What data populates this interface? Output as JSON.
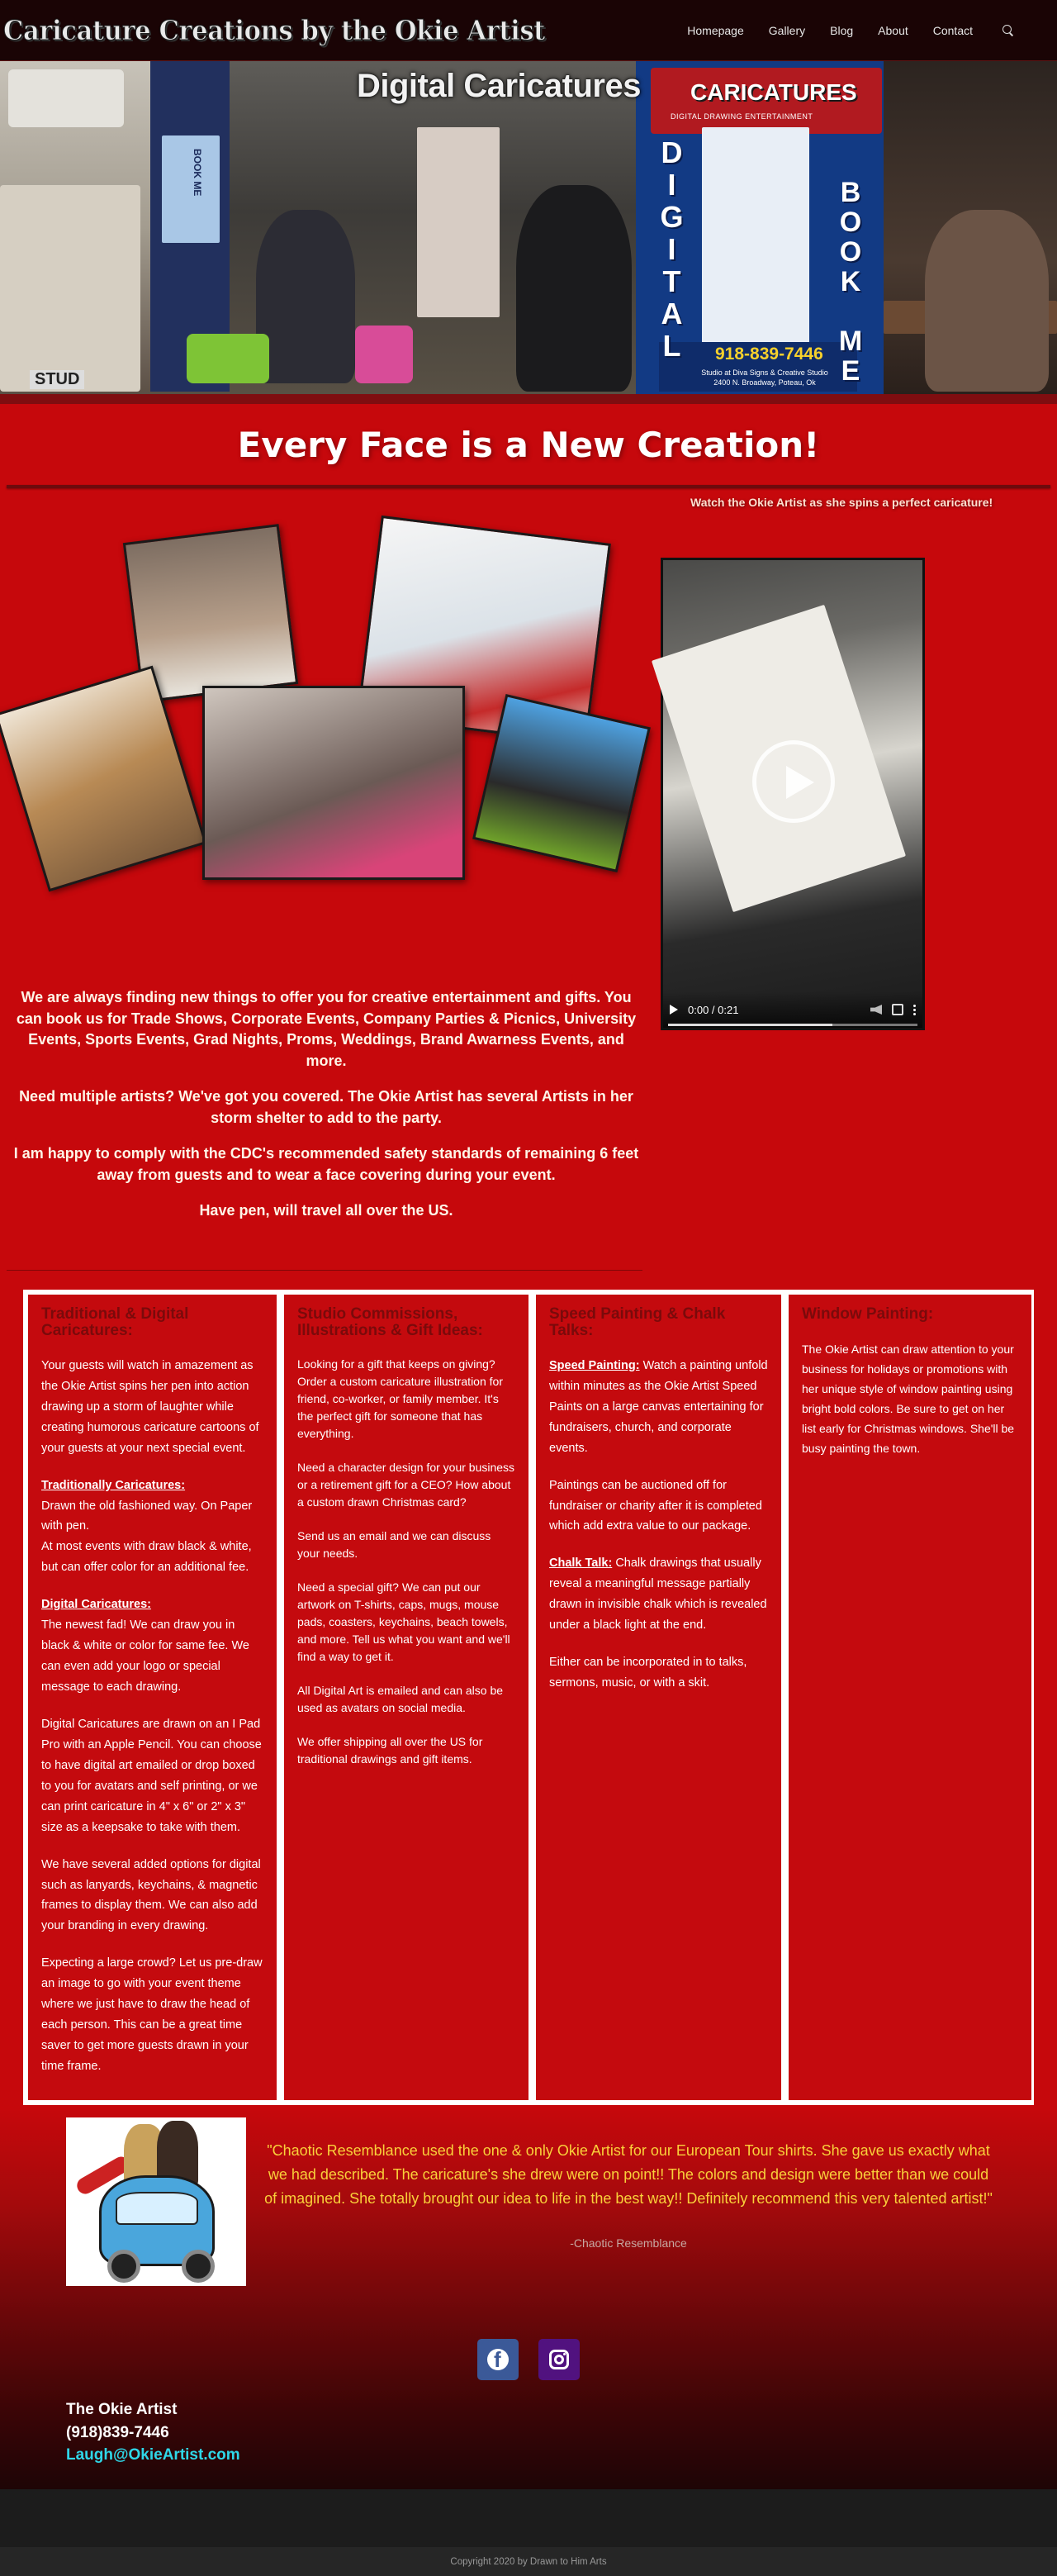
{
  "header": {
    "logo": "Caricature Creations by the Okie Artist",
    "nav": [
      "Homepage",
      "Gallery",
      "Blog",
      "About",
      "Contact"
    ]
  },
  "banner": {
    "title": "Digital Caricatures",
    "caricatures": "CARICATURES",
    "tagline": "DIGITAL DRAWING ENTERTAINMENT",
    "vertical_left": "DIGITAL",
    "vertical_right": "BOOK ME",
    "booth_label": "BOOK ME",
    "phone": "918-839-7446",
    "studio": "Studio at Diva Signs & Creative Studio 2400 N. Broadway, Poteau, Ok",
    "stud_sign": "STUD"
  },
  "hero": {
    "title": "Every Face is a New Creation!"
  },
  "video": {
    "caption": "Watch the Okie Artist as she spins a perfect caricature!",
    "time": "0:00 / 0:21",
    "progress": 0.66
  },
  "intro": {
    "paragraphs": [
      "We are always finding new things to offer you for creative entertainment and gifts. You can book us for Trade Shows, Corporate Events, Company Parties & Picnics, University Events, Sports Events, Grad Nights, Proms, Weddings, Brand Awarness Events, and more.",
      "Need multiple artists? We've got you covered. The Okie Artist has several Artists in her storm shelter to add to the party.",
      "I am happy to comply with the CDC's recommended safety standards of remaining 6 feet away from guests and to wear a face covering during your event.",
      "Have pen, will travel all over the US."
    ]
  },
  "columns": [
    {
      "title": "Traditional & Digital Caricatures:",
      "blocks": [
        {
          "lead": "",
          "text": "Your guests will watch in amazement as the Okie Artist spins her pen into action drawing up a storm of laughter while creating humorous caricature cartoons of your guests at your next special event."
        },
        {
          "lead": "Traditionally Caricatures:",
          "text": "Drawn the old fashioned way. On Paper with pen.\nAt most events with draw black & white, but can offer color for an additional fee."
        },
        {
          "lead": "Digital Caricatures:",
          "text": "The newest fad! We can draw you in black & white or color for same fee. We can even add your logo or special message to each drawing."
        },
        {
          "lead": "",
          "text": "Digital Caricatures are drawn on an I Pad Pro with an Apple Pencil. You can choose to have digital art emailed or drop boxed to you for avatars and self printing, or we can print caricature in 4\" x 6\" or 2\" x 3\" size as a keepsake to take with them."
        },
        {
          "lead": "",
          "text": "We have several added options for digital such as lanyards, keychains, & magnetic frames to display them. We can also add your branding in every drawing."
        },
        {
          "lead": "",
          "text": "Expecting a large crowd? Let us pre-draw an image to go with your event theme where we just have to draw the head of each person. This can be a great time saver to get more guests drawn in your time frame."
        }
      ]
    },
    {
      "title": "Studio Commissions, Illustrations & Gift Ideas:",
      "blocks": [
        {
          "lead": "",
          "text": "Looking for a gift that keeps on giving? Order a custom caricature illustration for friend, co-worker, or family member. It's the perfect gift for someone that has everything."
        },
        {
          "lead": "",
          "text": "Need a character design for your business or a retirement gift for a CEO? How about a custom drawn Christmas card?"
        },
        {
          "lead": "",
          "text": "Send us an email and we can discuss your needs."
        },
        {
          "lead": "",
          "text": "Need a special gift? We can put our artwork on T-shirts, caps, mugs, mouse pads, coasters, keychains, beach towels, and more. Tell us what you want and we'll find a way to get it."
        },
        {
          "lead": "",
          "text": "All Digital Art is emailed and can also be used as avatars on social media."
        },
        {
          "lead": "",
          "text": "We offer shipping all over the US for traditional drawings and gift items."
        }
      ]
    },
    {
      "title": "Speed Painting & Chalk Talks:",
      "blocks": [
        {
          "lead": "Speed Painting:",
          "text": "Watch a painting unfold within minutes as the Okie Artist Speed Paints on a large canvas entertaining for fundraisers, church, and corporate events."
        },
        {
          "lead": "",
          "text": "Paintings can be auctioned off for fundraiser or charity after it is completed which add extra value to our package."
        },
        {
          "lead": "Chalk Talk:",
          "text": "Chalk drawings that usually reveal a meaningful message partially drawn in invisible chalk which is revealed under a black light at the end."
        },
        {
          "lead": "",
          "text": "Either can be incorporated in to talks, sermons, music, or with a skit."
        }
      ]
    },
    {
      "title": "Window Painting:",
      "blocks": [
        {
          "lead": "",
          "text": "The Okie Artist can draw attention to your business for holidays or promotions with her unique style of window painting using bright bold colors. Be sure to get on her list early for Christmas windows. She'll be busy painting the town."
        }
      ]
    }
  ],
  "testimonial": {
    "quote": "\"Chaotic Resemblance used the one & only Okie Artist for our European Tour shirts. She gave us exactly what we had described. The caricature's she drew were on point!! The colors and design were better than we could of imagined. She totally brought our idea to life in the best way!! Definitely recommend this very talented artist!\"",
    "author": "-Chaotic Resemblance"
  },
  "social": [
    "facebook-icon",
    "instagram-icon"
  ],
  "contact": {
    "name": "The Okie Artist",
    "phone": "(918)839-7446",
    "email": "Laugh@OkieArtist.com"
  },
  "footer": {
    "copyright": "Copyright 2020 by Drawn to Him Arts"
  },
  "colors": {
    "background": "#c6080c",
    "header": "#1a0405",
    "heading_dark_red": "#7a0a0b",
    "quote_yellow": "#f9d03a",
    "email_cyan": "#2fd7e8"
  }
}
